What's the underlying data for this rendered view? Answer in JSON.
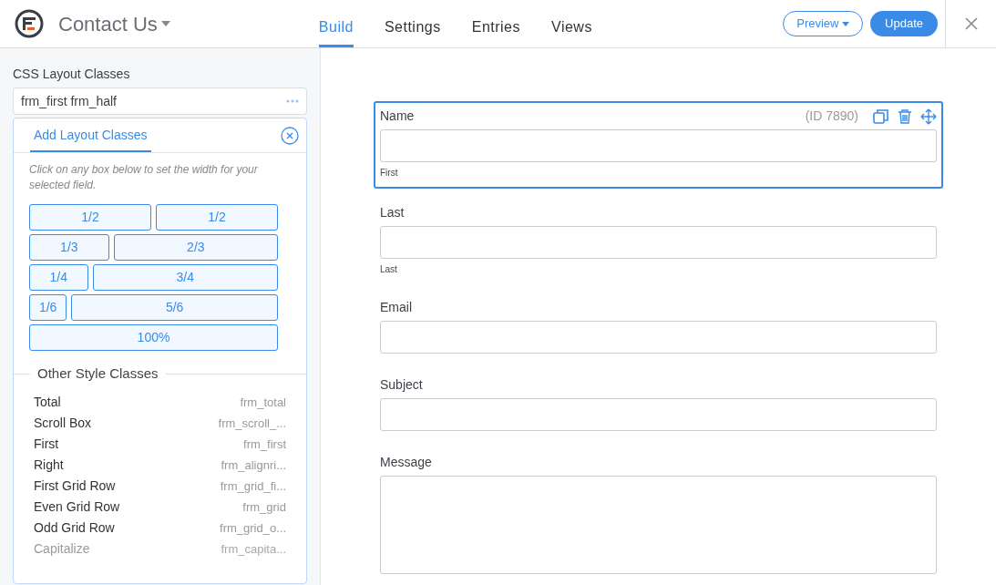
{
  "header": {
    "title": "Contact Us",
    "tabs": [
      {
        "label": "Build",
        "selected": true
      },
      {
        "label": "Settings",
        "selected": false
      },
      {
        "label": "Entries",
        "selected": false
      },
      {
        "label": "Views",
        "selected": false
      }
    ],
    "preview_button": "Preview",
    "update_button": "Update"
  },
  "sidebar": {
    "css_label": "CSS Layout Classes",
    "css_value": "frm_first frm_half",
    "panel_tab": "Add Layout Classes",
    "hint": "Click on any box below to set the width for your selected field.",
    "layout_rows": [
      [
        "1/2",
        "1/2"
      ],
      [
        "1/3",
        "2/3"
      ],
      [
        "1/4",
        "3/4"
      ],
      [
        "1/6",
        "5/6"
      ],
      [
        "100%"
      ]
    ],
    "other_title": "Other Style Classes",
    "style_classes": [
      {
        "name": "Total",
        "class": "frm_total",
        "faded": false
      },
      {
        "name": "Scroll Box",
        "class": "frm_scroll_...",
        "faded": false
      },
      {
        "name": "First",
        "class": "frm_first",
        "faded": false
      },
      {
        "name": "Right",
        "class": "frm_alignri...",
        "faded": false
      },
      {
        "name": "First Grid Row",
        "class": "frm_grid_fi...",
        "faded": false
      },
      {
        "name": "Even Grid Row",
        "class": "frm_grid",
        "faded": false
      },
      {
        "name": "Odd Grid Row",
        "class": "frm_grid_o...",
        "faded": false
      },
      {
        "name": "Capitalize",
        "class": "frm_capita...",
        "faded": true
      }
    ]
  },
  "form": {
    "fields": [
      {
        "label": "Name",
        "kind": "text",
        "selected": true,
        "id_text": "(ID 7890)",
        "sublabel": "First"
      },
      {
        "label": "Last",
        "kind": "text",
        "selected": false,
        "sublabel": "Last"
      },
      {
        "label": "Email",
        "kind": "text",
        "selected": false
      },
      {
        "label": "Subject",
        "kind": "text",
        "selected": false
      },
      {
        "label": "Message",
        "kind": "textarea",
        "selected": false
      }
    ]
  }
}
